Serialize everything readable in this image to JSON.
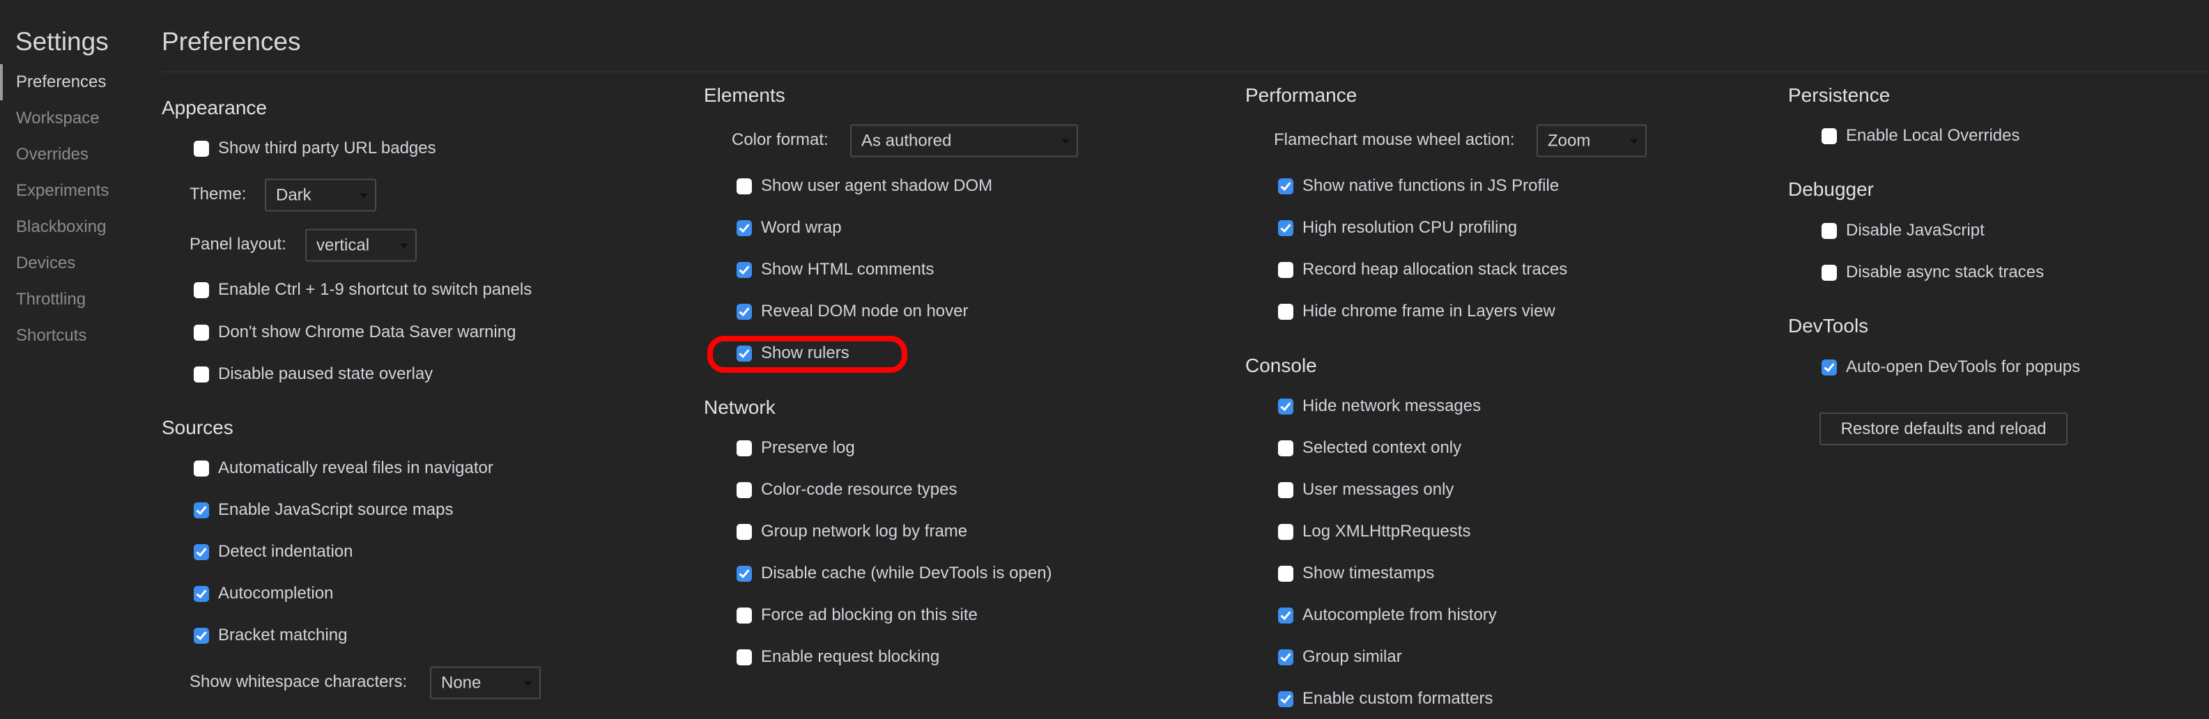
{
  "sidebar": {
    "title": "Settings",
    "items": [
      {
        "label": "Preferences",
        "active": true
      },
      {
        "label": "Workspace",
        "active": false
      },
      {
        "label": "Overrides",
        "active": false
      },
      {
        "label": "Experiments",
        "active": false
      },
      {
        "label": "Blackboxing",
        "active": false
      },
      {
        "label": "Devices",
        "active": false
      },
      {
        "label": "Throttling",
        "active": false
      },
      {
        "label": "Shortcuts",
        "active": false
      }
    ]
  },
  "header": {
    "title": "Preferences"
  },
  "colors": {
    "background": "#242424",
    "checkbox_checked": "#3c8ff1",
    "highlight": "#ff0000"
  },
  "appearance": {
    "heading": "Appearance",
    "show_third_party": {
      "label": "Show third party URL badges",
      "checked": false
    },
    "theme": {
      "label": "Theme:",
      "value": "Dark"
    },
    "panel_layout": {
      "label": "Panel layout:",
      "value": "vertical"
    },
    "ctrl_shortcut": {
      "label": "Enable Ctrl + 1-9 shortcut to switch panels",
      "checked": false
    },
    "data_saver": {
      "label": "Don't show Chrome Data Saver warning",
      "checked": false
    },
    "paused_overlay": {
      "label": "Disable paused state overlay",
      "checked": false
    }
  },
  "sources": {
    "heading": "Sources",
    "auto_reveal": {
      "label": "Automatically reveal files in navigator",
      "checked": false
    },
    "js_source_maps": {
      "label": "Enable JavaScript source maps",
      "checked": true
    },
    "detect_indentation": {
      "label": "Detect indentation",
      "checked": true
    },
    "autocompletion": {
      "label": "Autocompletion",
      "checked": true
    },
    "bracket_matching": {
      "label": "Bracket matching",
      "checked": true
    },
    "whitespace": {
      "label": "Show whitespace characters:",
      "value": "None"
    }
  },
  "elements": {
    "heading": "Elements",
    "color_format": {
      "label": "Color format:",
      "value": "As authored"
    },
    "shadow_dom": {
      "label": "Show user agent shadow DOM",
      "checked": false
    },
    "word_wrap": {
      "label": "Word wrap",
      "checked": true
    },
    "html_comments": {
      "label": "Show HTML comments",
      "checked": true
    },
    "reveal_dom": {
      "label": "Reveal DOM node on hover",
      "checked": true
    },
    "show_rulers": {
      "label": "Show rulers",
      "checked": true,
      "highlighted": true
    }
  },
  "network": {
    "heading": "Network",
    "preserve_log": {
      "label": "Preserve log",
      "checked": false
    },
    "color_code": {
      "label": "Color-code resource types",
      "checked": false
    },
    "group_by_frame": {
      "label": "Group network log by frame",
      "checked": false
    },
    "disable_cache": {
      "label": "Disable cache (while DevTools is open)",
      "checked": true
    },
    "force_ad_blocking": {
      "label": "Force ad blocking on this site",
      "checked": false
    },
    "request_blocking": {
      "label": "Enable request blocking",
      "checked": false
    }
  },
  "performance": {
    "heading": "Performance",
    "flamechart": {
      "label": "Flamechart mouse wheel action:",
      "value": "Zoom"
    },
    "native_functions": {
      "label": "Show native functions in JS Profile",
      "checked": true
    },
    "high_res_cpu": {
      "label": "High resolution CPU profiling",
      "checked": true
    },
    "heap_stack_traces": {
      "label": "Record heap allocation stack traces",
      "checked": false
    },
    "hide_chrome_frame": {
      "label": "Hide chrome frame in Layers view",
      "checked": false
    }
  },
  "console": {
    "heading": "Console",
    "hide_network": {
      "label": "Hide network messages",
      "checked": true
    },
    "selected_context": {
      "label": "Selected context only",
      "checked": false
    },
    "user_messages": {
      "label": "User messages only",
      "checked": false
    },
    "log_xhr": {
      "label": "Log XMLHttpRequests",
      "checked": false
    },
    "timestamps": {
      "label": "Show timestamps",
      "checked": false
    },
    "autocomplete_history": {
      "label": "Autocomplete from history",
      "checked": true
    },
    "group_similar": {
      "label": "Group similar",
      "checked": true
    },
    "custom_formatters": {
      "label": "Enable custom formatters",
      "checked": true
    }
  },
  "persistence": {
    "heading": "Persistence",
    "local_overrides": {
      "label": "Enable Local Overrides",
      "checked": false
    }
  },
  "debugger": {
    "heading": "Debugger",
    "disable_js": {
      "label": "Disable JavaScript",
      "checked": false
    },
    "disable_async": {
      "label": "Disable async stack traces",
      "checked": false
    }
  },
  "devtools": {
    "heading": "DevTools",
    "auto_open_popups": {
      "label": "Auto-open DevTools for popups",
      "checked": true
    },
    "restore_button": "Restore defaults and reload"
  }
}
